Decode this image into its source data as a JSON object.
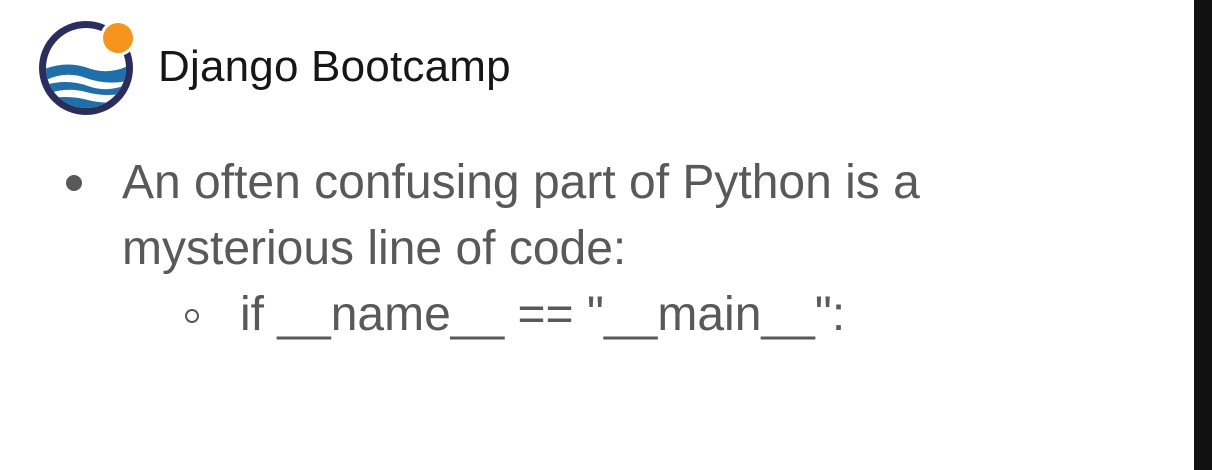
{
  "header": {
    "title": "Django Bootcamp",
    "logo_icon": "sunset-waves-logo-icon"
  },
  "content": {
    "bullet_1_line_1": "An often confusing part of Python is a",
    "bullet_1_line_2": "mysterious line of code:",
    "bullet_2": "if __name__ == \"__main__\":"
  },
  "colors": {
    "logo_ring": "#2b2e5c",
    "logo_sun": "#f7941d",
    "logo_wave": "#1f6fa8",
    "body_text": "#595959",
    "title_text": "#161616"
  }
}
